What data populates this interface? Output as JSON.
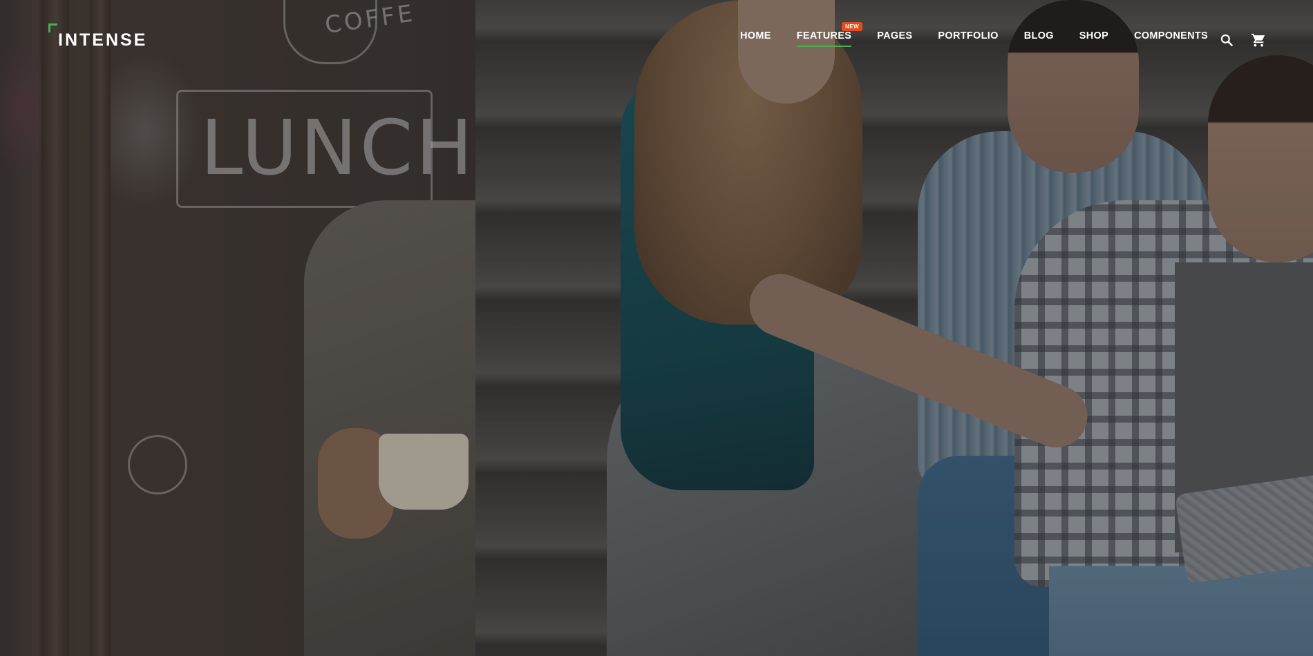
{
  "header": {
    "logo_text": "INTENSE",
    "nav": [
      {
        "label": "HOME",
        "active": false,
        "badge": ""
      },
      {
        "label": "FEATURES",
        "active": true,
        "badge": "NEW"
      },
      {
        "label": "PAGES",
        "active": false,
        "badge": ""
      },
      {
        "label": "PORTFOLIO",
        "active": false,
        "badge": ""
      },
      {
        "label": "BLOG",
        "active": false,
        "badge": ""
      },
      {
        "label": "SHOP",
        "active": false,
        "badge": ""
      },
      {
        "label": "COMPONENTS",
        "active": false,
        "badge": ""
      }
    ],
    "icons": {
      "search": "search-icon",
      "cart": "cart-icon"
    }
  },
  "colors": {
    "accent": "#4caf50",
    "badge": "#e64a19",
    "nav_text": "#ffffff"
  },
  "hero": {
    "left_photo_chalk_text": [
      "COFFE",
      "LUNCH"
    ]
  }
}
